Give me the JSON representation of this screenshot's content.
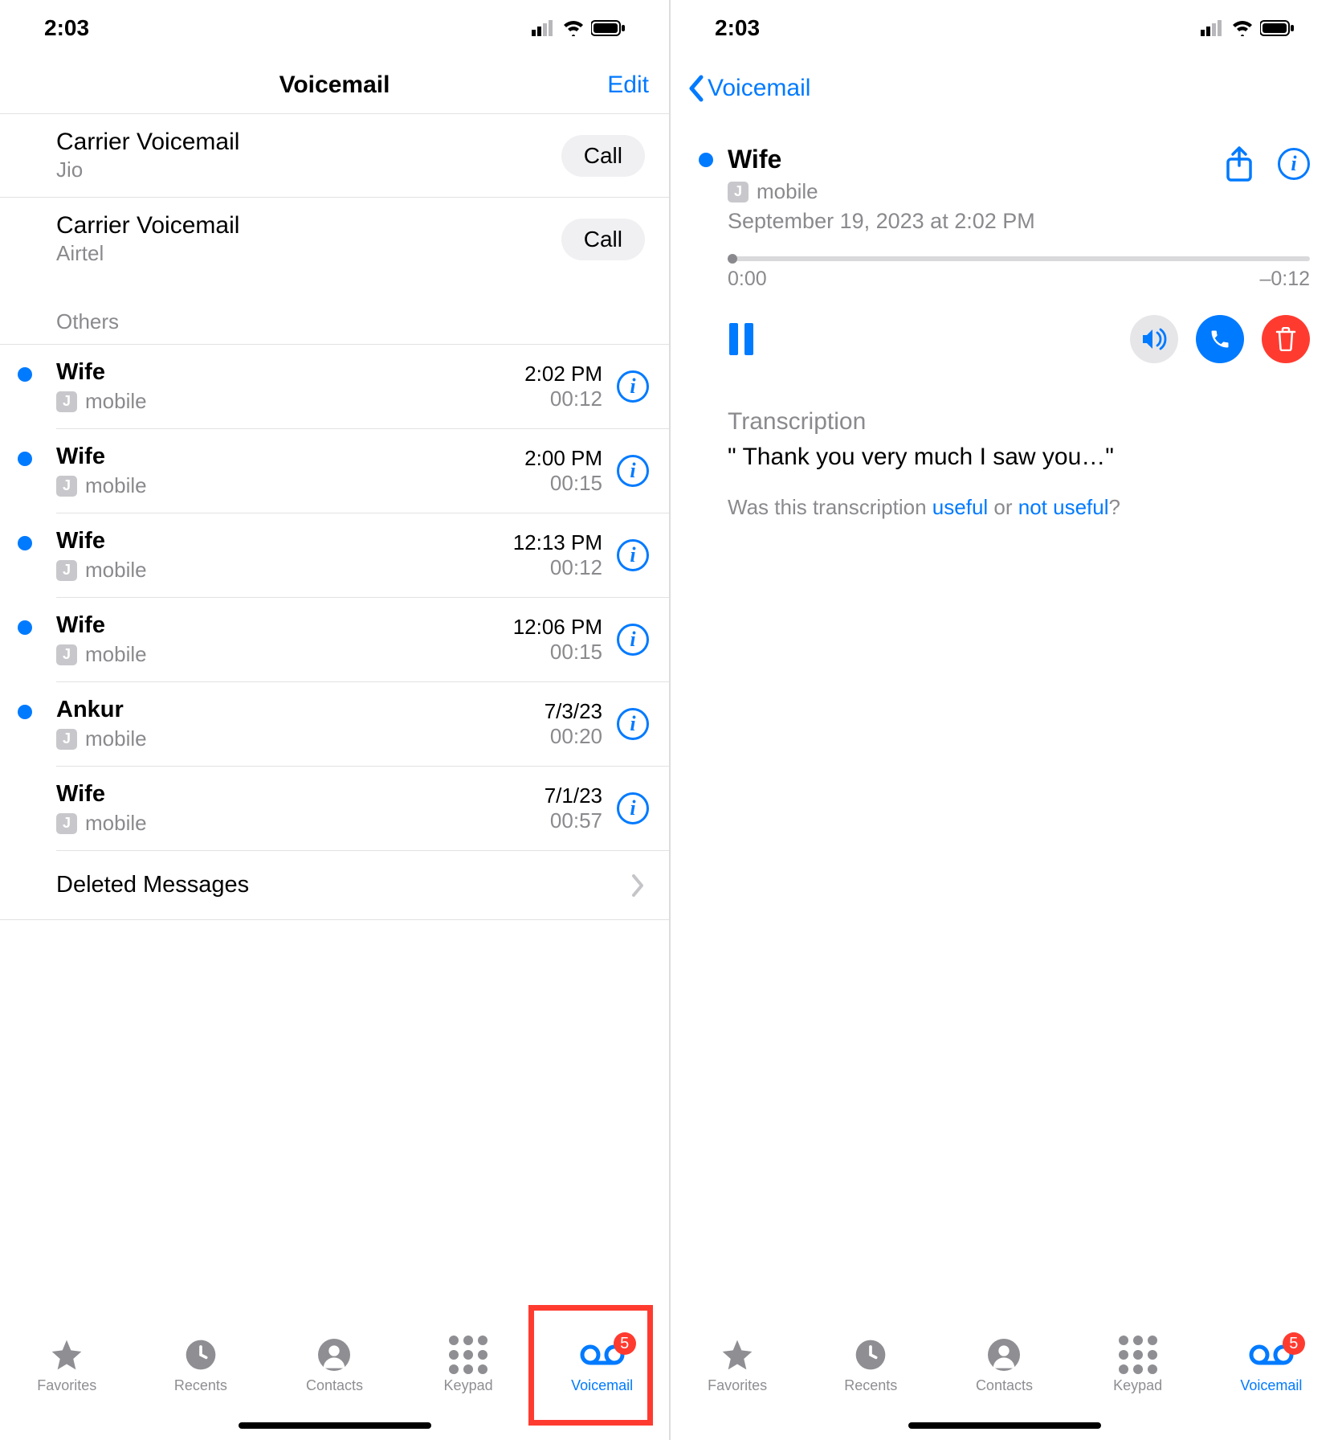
{
  "status": {
    "time": "2:03"
  },
  "list": {
    "title": "Voicemail",
    "edit_label": "Edit",
    "carriers": [
      {
        "name": "Carrier Voicemail",
        "sub": "Jio",
        "button": "Call"
      },
      {
        "name": "Carrier Voicemail",
        "sub": "Airtel",
        "button": "Call"
      }
    ],
    "section_header": "Others",
    "items": [
      {
        "name": "Wife",
        "label": "mobile",
        "time": "2:02 PM",
        "duration": "00:12",
        "unread": true
      },
      {
        "name": "Wife",
        "label": "mobile",
        "time": "2:00 PM",
        "duration": "00:15",
        "unread": true
      },
      {
        "name": "Wife",
        "label": "mobile",
        "time": "12:13 PM",
        "duration": "00:12",
        "unread": true
      },
      {
        "name": "Wife",
        "label": "mobile",
        "time": "12:06 PM",
        "duration": "00:15",
        "unread": true
      },
      {
        "name": "Ankur",
        "label": "mobile",
        "time": "7/3/23",
        "duration": "00:20",
        "unread": true
      },
      {
        "name": "Wife",
        "label": "mobile",
        "time": "7/1/23",
        "duration": "00:57",
        "unread": false
      }
    ],
    "deleted_label": "Deleted Messages"
  },
  "detail": {
    "back_label": "Voicemail",
    "name": "Wife",
    "label": "mobile",
    "date": "September 19, 2023 at 2:02 PM",
    "elapsed": "0:00",
    "remaining": "–0:12",
    "transcription_title": "Transcription",
    "transcription_text": "\" Thank you very much I saw you…\"",
    "feedback_prefix": "Was this transcription ",
    "feedback_useful": "useful",
    "feedback_or": " or ",
    "feedback_not_useful": "not useful",
    "feedback_suffix": "?"
  },
  "tabs": {
    "favorites": "Favorites",
    "recents": "Recents",
    "contacts": "Contacts",
    "keypad": "Keypad",
    "voicemail": "Voicemail",
    "badge": "5"
  },
  "j_badge": "J"
}
